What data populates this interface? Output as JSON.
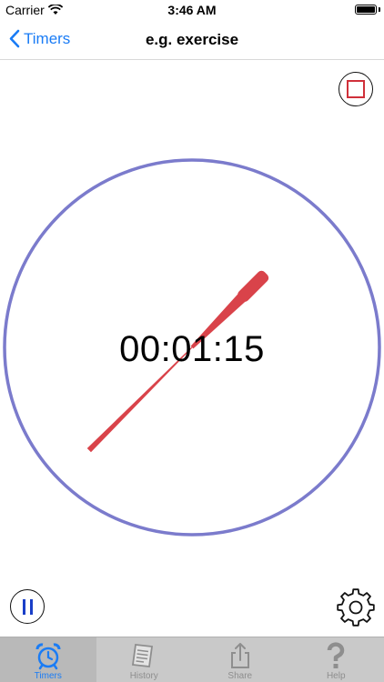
{
  "status_bar": {
    "carrier": "Carrier",
    "time": "3:46 AM"
  },
  "nav": {
    "back_label": "Timers",
    "title": "e.g. exercise"
  },
  "timer": {
    "display": "00:01:15"
  },
  "tabs": [
    {
      "label": "Timers",
      "icon": "alarm-clock-icon",
      "active": true
    },
    {
      "label": "History",
      "icon": "document-icon",
      "active": false
    },
    {
      "label": "Share",
      "icon": "share-icon",
      "active": false
    },
    {
      "label": "Help",
      "icon": "question-icon",
      "active": false
    }
  ],
  "colors": {
    "accent": "#1a7cf5",
    "dial_ring": "#7b7bcc",
    "hand": "#d9434a",
    "stop": "#d0303a",
    "pause": "#1a3fc8",
    "tab_bar": "#c9c9c9"
  }
}
